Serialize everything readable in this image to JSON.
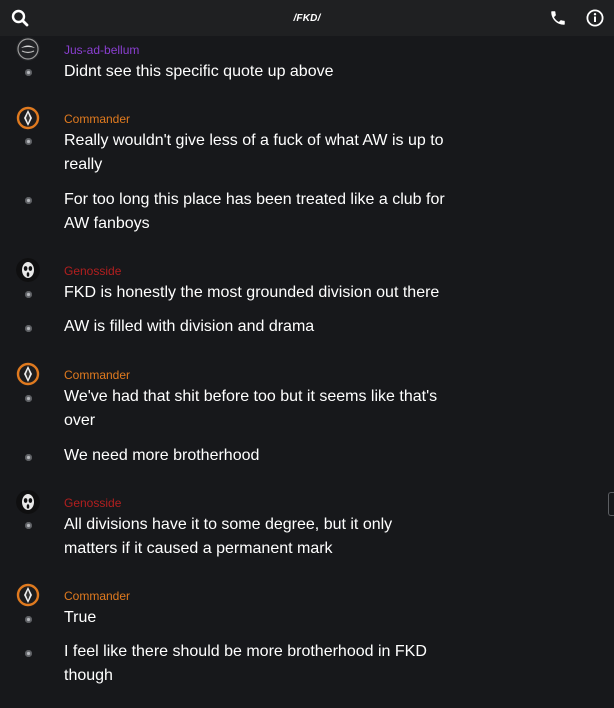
{
  "header": {
    "title": "/FKD/",
    "icons": [
      "search-icon",
      "phone-icon",
      "info-icon"
    ]
  },
  "colors": {
    "background": "#17181b",
    "topbar": "#1f2022",
    "jus": "#8a3fd1",
    "commander": "#e07a1f",
    "genosside": "#b21f1f"
  },
  "messages": [
    {
      "author": "Jus-ad-bellum",
      "lines": [
        "Didnt see this specific quote up above"
      ]
    },
    {
      "author": "Commander",
      "lines": [
        "Really wouldn't give less of a fuck of what AW is up to really",
        "For too long this place has been treated like a club for AW fanboys"
      ]
    },
    {
      "author": "Genosside",
      "lines": [
        "FKD is honestly the most grounded division out there",
        "AW is filled with division and drama"
      ]
    },
    {
      "author": "Commander",
      "lines": [
        "We've had that shit before too but it seems like that's over",
        "We need more brotherhood"
      ]
    },
    {
      "author": "Genosside",
      "lines": [
        "All divisions have it to some degree, but it only matters if it caused a permanent mark"
      ]
    },
    {
      "author": "Commander",
      "lines": [
        "True",
        "I feel like there should be more brotherhood in FKD though"
      ]
    }
  ]
}
